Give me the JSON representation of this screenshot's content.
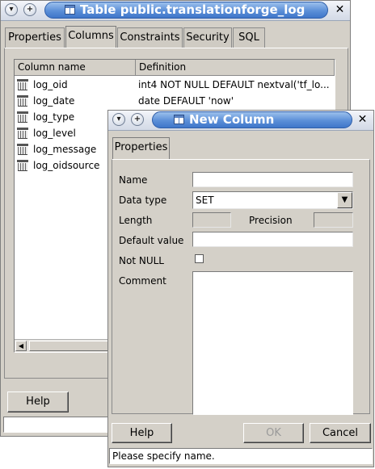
{
  "main_window": {
    "title": "Table public.translationforge_log",
    "tabs": [
      {
        "label": "Properties",
        "active": false
      },
      {
        "label": "Columns",
        "active": true
      },
      {
        "label": "Constraints",
        "active": false
      },
      {
        "label": "Security",
        "active": false
      },
      {
        "label": "SQL",
        "active": false
      }
    ],
    "columns_header": {
      "name": "Column name",
      "definition": "Definition"
    },
    "columns": [
      {
        "name": "log_oid",
        "definition": "int4 NOT NULL DEFAULT nextval('tf_lo..."
      },
      {
        "name": "log_date",
        "definition": "date DEFAULT 'now'"
      },
      {
        "name": "log_type",
        "definition": ""
      },
      {
        "name": "log_level",
        "definition": ""
      },
      {
        "name": "log_message",
        "definition": ""
      },
      {
        "name": "log_oidsource",
        "definition": ""
      }
    ],
    "help_label": "Help",
    "status_text": ""
  },
  "dialog": {
    "title": "New Column",
    "tab": "Properties",
    "fields": {
      "name_label": "Name",
      "name_value": "",
      "data_type_label": "Data type",
      "data_type_value": "SET",
      "length_label": "Length",
      "precision_label": "Precision",
      "default_label": "Default value",
      "default_value": "",
      "not_null_label": "Not NULL",
      "not_null_checked": false,
      "comment_label": "Comment",
      "comment_value": ""
    },
    "buttons": {
      "help": "Help",
      "ok": "OK",
      "cancel": "Cancel"
    },
    "status_text": "Please specify name."
  },
  "icons": {
    "menu": "chevron-down-icon",
    "pin": "plus-icon",
    "close": "close-icon",
    "table": "table-icon",
    "column": "column-icon"
  },
  "colors": {
    "title_accent": "#5b8fd8",
    "window_bg": "#d4d0c8"
  }
}
